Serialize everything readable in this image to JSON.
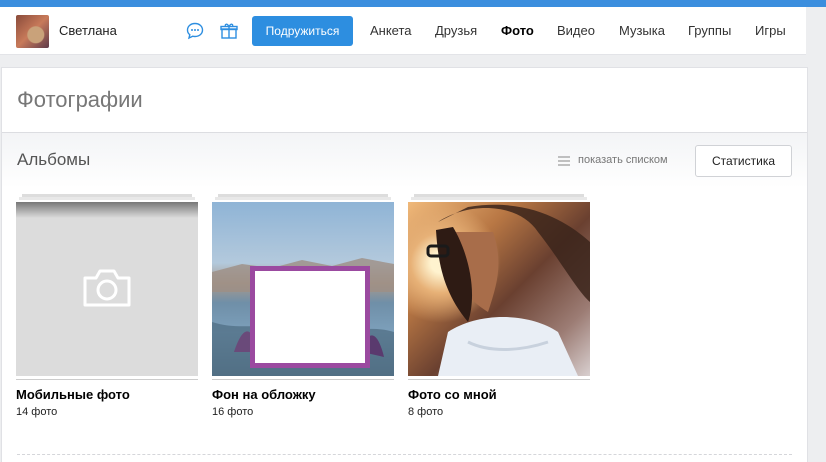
{
  "header": {
    "user_name": "Светлана",
    "join_button": "Подружиться",
    "nav": [
      {
        "label": "Анкета",
        "active": false
      },
      {
        "label": "Друзья",
        "active": false
      },
      {
        "label": "Фото",
        "active": true
      },
      {
        "label": "Видео",
        "active": false
      },
      {
        "label": "Музыка",
        "active": false
      },
      {
        "label": "Группы",
        "active": false
      },
      {
        "label": "Игры",
        "active": false
      }
    ],
    "icons": [
      "message-icon",
      "gift-icon"
    ],
    "accent_color": "#2d8ee0"
  },
  "page": {
    "title": "Фотографии",
    "albums_title": "Альбомы",
    "list_link": "показать списком",
    "stats_button": "Статистика"
  },
  "albums": [
    {
      "name": "Мобильные фото",
      "count": "14 фото"
    },
    {
      "name": "Фон на обложку",
      "count": "16 фото"
    },
    {
      "name": "Фото со мной",
      "count": "8 фото"
    }
  ]
}
